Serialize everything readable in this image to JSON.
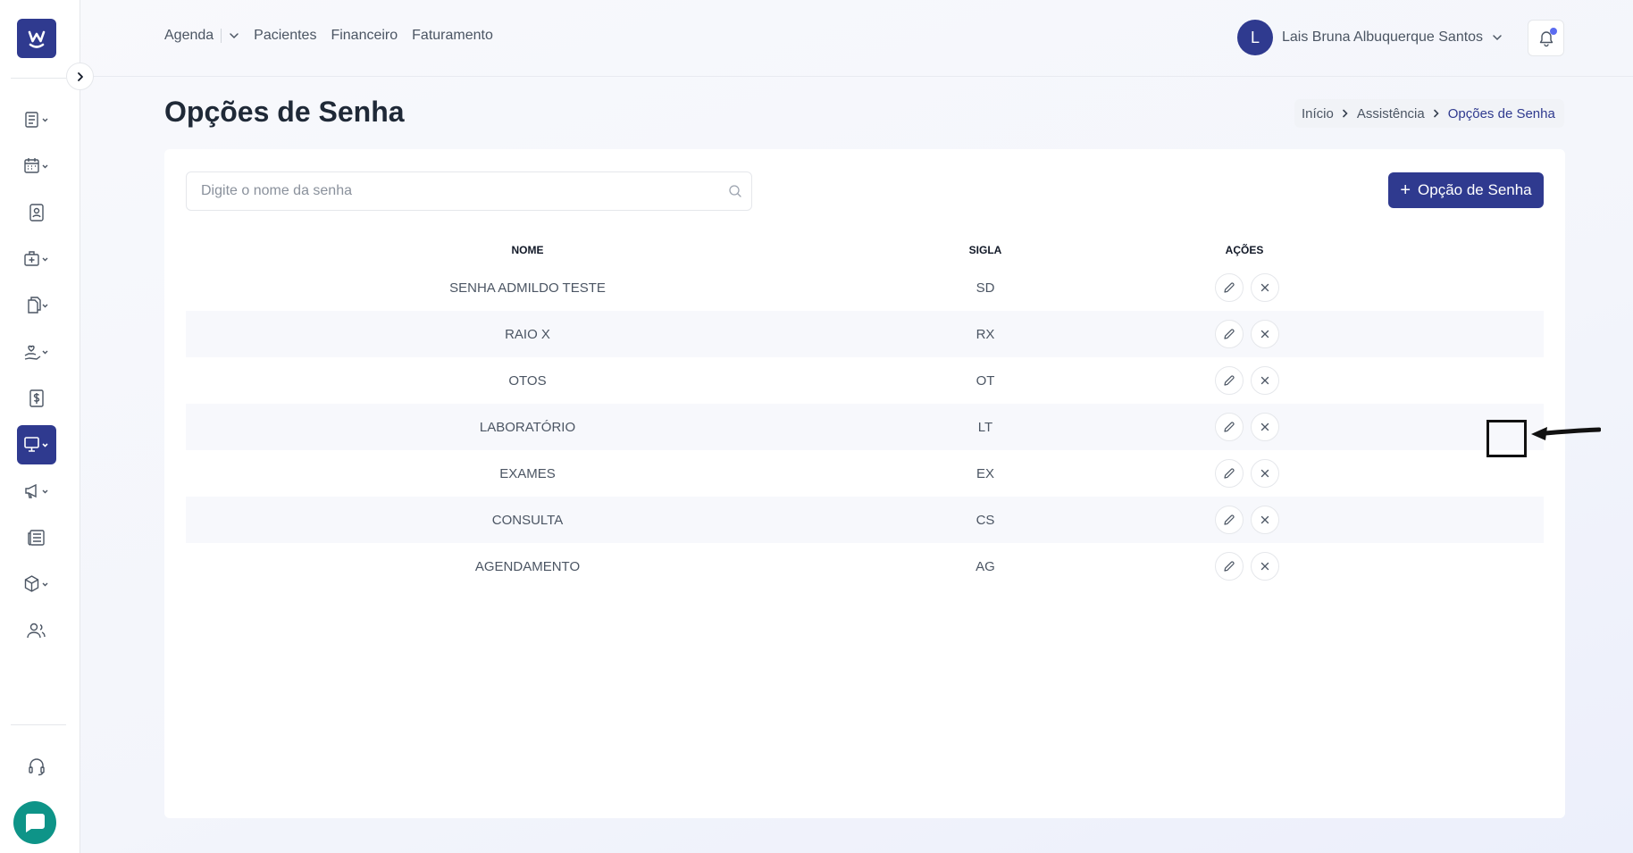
{
  "app": {
    "logo": "w-logo"
  },
  "header": {
    "nav": [
      {
        "label": "Agenda"
      },
      {
        "label": "Pacientes"
      },
      {
        "label": "Financeiro"
      },
      {
        "label": "Faturamento"
      }
    ],
    "user": {
      "initial": "L",
      "name": "Lais Bruna Albuquerque Santos"
    }
  },
  "sidebar": {
    "items": [
      {
        "icon": "document-list-icon"
      },
      {
        "icon": "calendar-icon"
      },
      {
        "icon": "patient-card-icon"
      },
      {
        "icon": "medical-bag-icon"
      },
      {
        "icon": "documents-icon"
      },
      {
        "icon": "hand-care-icon"
      },
      {
        "icon": "dollar-icon"
      },
      {
        "icon": "monitor-icon",
        "active": true
      },
      {
        "icon": "megaphone-icon"
      },
      {
        "icon": "newspaper-icon"
      },
      {
        "icon": "package-icon"
      },
      {
        "icon": "users-icon"
      },
      {
        "icon": "headset-icon"
      }
    ]
  },
  "page": {
    "title": "Opções de Senha",
    "breadcrumb": [
      "Início",
      "Assistência",
      "Opções de Senha"
    ]
  },
  "search": {
    "placeholder": "Digite o nome da senha",
    "value": ""
  },
  "add_button": {
    "label": "Opção de Senha"
  },
  "table": {
    "headers": {
      "nome": "NOME",
      "sigla": "SIGLA",
      "acoes": "AÇÕES"
    },
    "rows": [
      {
        "nome": "SENHA ADMILDO TESTE",
        "sigla": "SD"
      },
      {
        "nome": "RAIO X",
        "sigla": "RX"
      },
      {
        "nome": "OTOS",
        "sigla": "OT"
      },
      {
        "nome": "LABORATÓRIO",
        "sigla": "LT"
      },
      {
        "nome": "EXAMES",
        "sigla": "EX"
      },
      {
        "nome": "CONSULTA",
        "sigla": "CS"
      },
      {
        "nome": "AGENDAMENTO",
        "sigla": "AG"
      }
    ]
  },
  "colors": {
    "primary": "#2f3a8f",
    "chat": "#0e9488",
    "notification": "#5b6cf0"
  }
}
